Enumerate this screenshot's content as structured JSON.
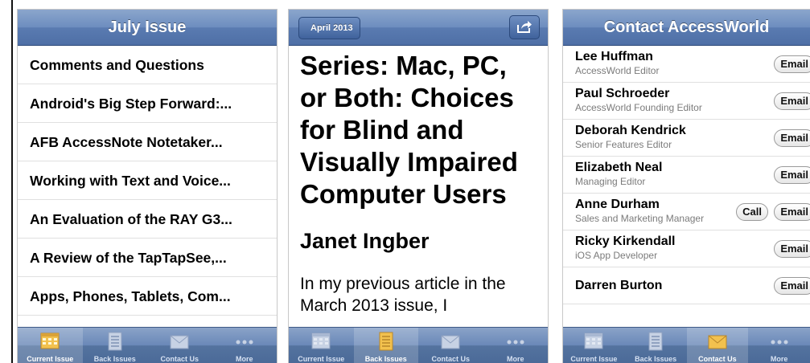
{
  "screen1": {
    "title": "July Issue",
    "items": [
      "Comments and Questions",
      "Android's Big Step Forward:...",
      "AFB AccessNote Notetaker...",
      "Working with Text and Voice...",
      "An Evaluation of the RAY G3...",
      "A Review of the TapTapSee,...",
      "Apps, Phones, Tablets, Com..."
    ],
    "tabs": [
      "Current Issue",
      "Back Issues",
      "Contact Us",
      "More"
    ]
  },
  "screen2": {
    "back_label": "April 2013",
    "article_title": "Series: Mac, PC, or Both: Choices for Blind and Visually Impaired Computer Users",
    "author": "Janet Ingber",
    "body": "In my previous article in the March 2013 issue, I",
    "tabs": [
      "Current Issue",
      "Back Issues",
      "Contact Us",
      "More"
    ]
  },
  "screen3": {
    "title": "Contact AccessWorld",
    "email_label": "Email",
    "call_label": "Call",
    "contacts": [
      {
        "name": "Lee Huffman",
        "role": "AccessWorld Editor"
      },
      {
        "name": "Paul Schroeder",
        "role": "AccessWorld Founding Editor"
      },
      {
        "name": "Deborah Kendrick",
        "role": "Senior Features Editor"
      },
      {
        "name": "Elizabeth Neal",
        "role": "Managing Editor"
      },
      {
        "name": "Anne Durham",
        "role": "Sales and Marketing Manager"
      },
      {
        "name": "Ricky Kirkendall",
        "role": "iOS App Developer"
      },
      {
        "name": "Darren Burton",
        "role": ""
      }
    ],
    "tabs": [
      "Current Issue",
      "Back Issues",
      "Contact Us",
      "More"
    ]
  },
  "colors": {
    "navbar": "#5a7bb1",
    "tabbar": "#54739f",
    "active_icon": "#f2c14e"
  },
  "icons": [
    "calendar-grid-icon",
    "document-stack-icon",
    "envelope-icon",
    "more-dots-icon",
    "share-icon"
  ]
}
